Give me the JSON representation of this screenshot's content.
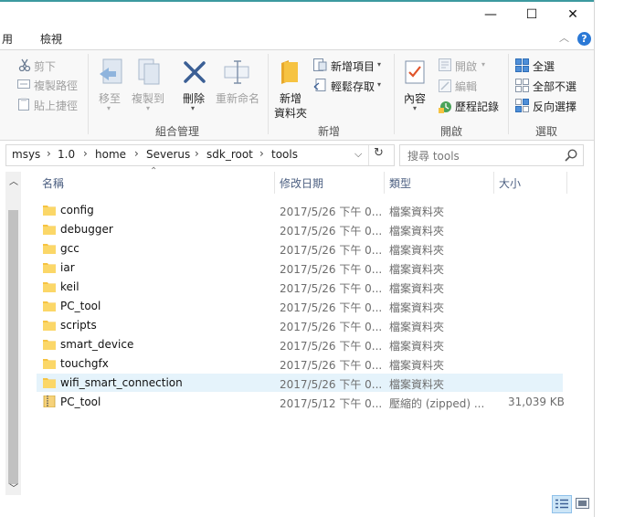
{
  "window": {
    "caption_buttons": {
      "minimize": "—",
      "maximize": "☐",
      "close": "✕"
    }
  },
  "ribbon_tabs": {
    "edge_text": "用",
    "view_tab": "檢視"
  },
  "ribbon": {
    "clipboard": {
      "cut": "剪下",
      "copy_path": "複製路徑",
      "paste_shortcut": "貼上捷徑"
    },
    "organize": {
      "move_to": "移至",
      "copy_to": "複製到",
      "delete": "刪除",
      "rename": "重新命名",
      "group_title": "組合管理"
    },
    "new": {
      "new_folder_l1": "新增",
      "new_folder_l2": "資料夾",
      "new_item": "新增項目",
      "easy_access": "輕鬆存取",
      "group_title": "新增"
    },
    "open": {
      "properties": "內容",
      "open": "開啟",
      "edit": "編輯",
      "history": "歷程記錄",
      "group_title": "開啟"
    },
    "select": {
      "select_all": "全選",
      "select_none": "全部不選",
      "invert": "反向選擇",
      "group_title": "選取"
    }
  },
  "address": {
    "crumbs": [
      "msys",
      "1.0",
      "home",
      "Severus",
      "sdk_root",
      "tools"
    ],
    "separator": "›"
  },
  "search": {
    "placeholder": "搜尋 tools"
  },
  "columns": {
    "name": "名稱",
    "date": "修改日期",
    "type": "類型",
    "size": "大小"
  },
  "files": [
    {
      "name": "config",
      "date": "2017/5/26 下午 0...",
      "type": "檔案資料夾",
      "size": ""
    },
    {
      "name": "debugger",
      "date": "2017/5/26 下午 0...",
      "type": "檔案資料夾",
      "size": ""
    },
    {
      "name": "gcc",
      "date": "2017/5/26 下午 0...",
      "type": "檔案資料夾",
      "size": ""
    },
    {
      "name": "iar",
      "date": "2017/5/26 下午 0...",
      "type": "檔案資料夾",
      "size": ""
    },
    {
      "name": "keil",
      "date": "2017/5/26 下午 0...",
      "type": "檔案資料夾",
      "size": ""
    },
    {
      "name": "PC_tool",
      "date": "2017/5/26 下午 0...",
      "type": "檔案資料夾",
      "size": ""
    },
    {
      "name": "scripts",
      "date": "2017/5/26 下午 0...",
      "type": "檔案資料夾",
      "size": ""
    },
    {
      "name": "smart_device",
      "date": "2017/5/26 下午 0...",
      "type": "檔案資料夾",
      "size": ""
    },
    {
      "name": "touchgfx",
      "date": "2017/5/26 下午 0...",
      "type": "檔案資料夾",
      "size": ""
    },
    {
      "name": "wifi_smart_connection",
      "date": "2017/5/26 下午 0...",
      "type": "檔案資料夾",
      "size": ""
    },
    {
      "name": "PC_tool",
      "date": "2017/5/12 下午 0...",
      "type": "壓縮的 (zipped) ...",
      "size": "31,039 KB"
    }
  ],
  "colors": {
    "accent": "#2b79d6",
    "selected_row": "#e5f3fb",
    "folder": "#f6c342"
  }
}
